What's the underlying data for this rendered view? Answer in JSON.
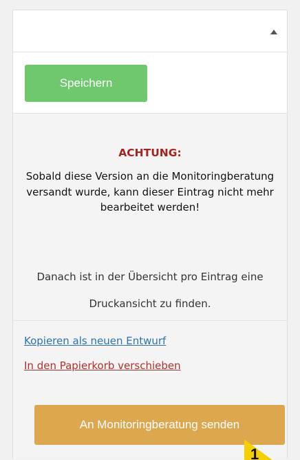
{
  "save_button": {
    "label": "Speichern"
  },
  "notice": {
    "title": "ACHTUNG:",
    "body": "Sobald diese Version an die Monitoringberatung versandt wurde, kann dieser Eintrag nicht mehr bearbeitet werden!",
    "extra": "Danach ist in der Übersicht pro Eintrag eine Druckansicht zu finden."
  },
  "links": {
    "copy": "Kopieren als neuen Entwurf",
    "trash": "In den Papierkorb verschieben"
  },
  "send_button": {
    "label": "An Monitoringberatung senden"
  },
  "cursor": {
    "label": "1"
  },
  "colors": {
    "save": "#70c86e",
    "send": "#dca74f",
    "warning": "#a32320",
    "link": "#2d73b4",
    "trash_link": "#b0302d"
  },
  "icons": {
    "collapse": "triangle-up-icon",
    "cursor": "arrow-cursor-icon"
  }
}
